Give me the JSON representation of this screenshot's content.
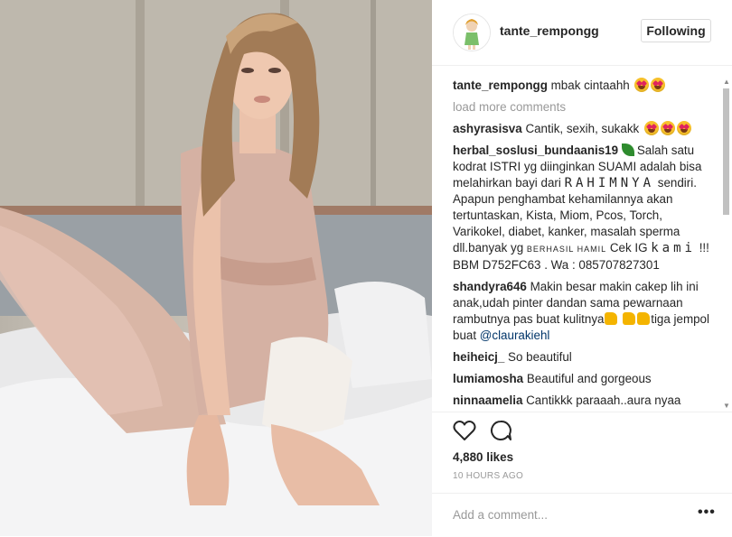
{
  "post": {
    "username": "tante_rempongg",
    "follow_label": "Following",
    "caption_user": "tante_rempongg",
    "caption_text": "mbak cintaahh",
    "load_more": "load more comments",
    "likes": "4,880 likes",
    "time": "10 HOURS AGO",
    "add_comment_placeholder": "Add a comment...",
    "more_label": "•••"
  },
  "comments": [
    {
      "user": "ashyrasisva",
      "text": "Cantik, sexih, sukakk"
    },
    {
      "user": "herbal_soslusi_bundaanis19",
      "text_a": "Salah satu kodrat ISTRI yg diinginkan SUAMI adalah bisa melahirkan bayi dari",
      "text_spaced_a": "RAHIMNYA",
      "text_b": "sendiri. Apapun penghambat kehamilannya akan tertuntaskan, Kista, Miom, Pcos, Torch, Varikokel, diabet, kanker, masalah sperma dll.banyak yg",
      "text_small": "BERHASIL HAMIL",
      "text_c": "Cek IG",
      "text_spaced_b": "kami",
      "text_d": "!!! BBM D752FC63 . Wa : 085707827301"
    },
    {
      "user": "shandyra646",
      "text_a": "Makin besar makin cakep lih ini anak,udah pinter dandan sama pewarnaan rambutnya pas buat kulitnya",
      "text_b": "tiga jempol buat",
      "mention": "@claurakiehl"
    },
    {
      "user": "heiheicj_",
      "text": "So beautiful"
    },
    {
      "user": "lumiamosha",
      "text": "Beautiful and gorgeous"
    },
    {
      "user": "ninnaamelia",
      "text": "Cantikkk paraaah..aura nyaa"
    }
  ],
  "icons": {
    "heart": "heart-icon",
    "comment": "comment-icon",
    "avatar": "avatar-illustration",
    "emoji": "heart-eyes-emoji",
    "thumb": "thumbs-up-emoji",
    "leaf": "leaf-emoji"
  }
}
